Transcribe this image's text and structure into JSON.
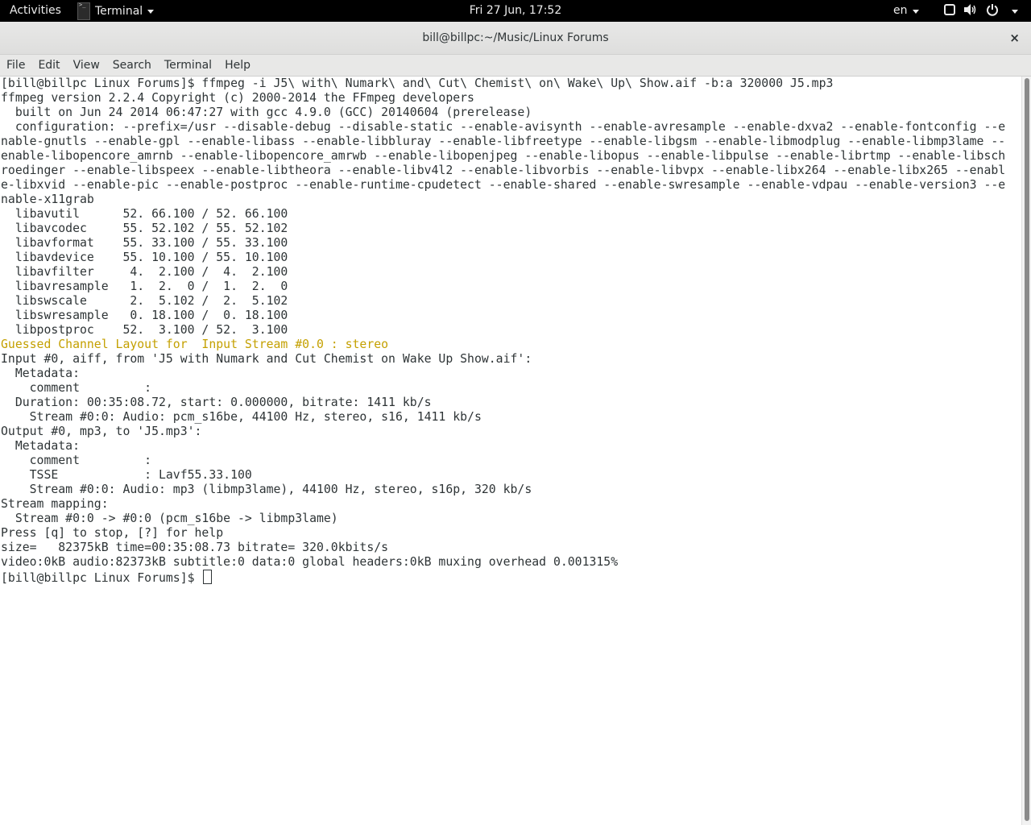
{
  "topbar": {
    "activities": "Activities",
    "app_name": "Terminal",
    "clock": "Fri 27 Jun, 17:52",
    "language": "en"
  },
  "window": {
    "title": "bill@billpc:~/Music/Linux Forums",
    "close": "×"
  },
  "menubar": {
    "items": [
      "File",
      "Edit",
      "View",
      "Search",
      "Terminal",
      "Help"
    ]
  },
  "terminal": {
    "lines": [
      "[bill@billpc Linux Forums]$ ffmpeg -i J5\\ with\\ Numark\\ and\\ Cut\\ Chemist\\ on\\ Wake\\ Up\\ Show.aif -b:a 320000 J5.mp3",
      "ffmpeg version 2.2.4 Copyright (c) 2000-2014 the FFmpeg developers",
      "  built on Jun 24 2014 06:47:27 with gcc 4.9.0 (GCC) 20140604 (prerelease)",
      "  configuration: --prefix=/usr --disable-debug --disable-static --enable-avisynth --enable-avresample --enable-dxva2 --enable-fontconfig --e",
      "nable-gnutls --enable-gpl --enable-libass --enable-libbluray --enable-libfreetype --enable-libgsm --enable-libmodplug --enable-libmp3lame --",
      "enable-libopencore_amrnb --enable-libopencore_amrwb --enable-libopenjpeg --enable-libopus --enable-libpulse --enable-librtmp --enable-libsch",
      "roedinger --enable-libspeex --enable-libtheora --enable-libv4l2 --enable-libvorbis --enable-libvpx --enable-libx264 --enable-libx265 --enabl",
      "e-libxvid --enable-pic --enable-postproc --enable-runtime-cpudetect --enable-shared --enable-swresample --enable-vdpau --enable-version3 --e",
      "nable-x11grab",
      "  libavutil      52. 66.100 / 52. 66.100",
      "  libavcodec     55. 52.102 / 55. 52.102",
      "  libavformat    55. 33.100 / 55. 33.100",
      "  libavdevice    55. 10.100 / 55. 10.100",
      "  libavfilter     4.  2.100 /  4.  2.100",
      "  libavresample   1.  2.  0 /  1.  2.  0",
      "  libswscale      2.  5.102 /  2.  5.102",
      "  libswresample   0. 18.100 /  0. 18.100",
      "  libpostproc    52.  3.100 / 52.  3.100",
      "Guessed Channel Layout for  Input Stream #0.0 : stereo",
      "Input #0, aiff, from 'J5 with Numark and Cut Chemist on Wake Up Show.aif':",
      "  Metadata:",
      "    comment         :",
      "  Duration: 00:35:08.72, start: 0.000000, bitrate: 1411 kb/s",
      "    Stream #0:0: Audio: pcm_s16be, 44100 Hz, stereo, s16, 1411 kb/s",
      "Output #0, mp3, to 'J5.mp3':",
      "  Metadata:",
      "    comment         :",
      "    TSSE            : Lavf55.33.100",
      "    Stream #0:0: Audio: mp3 (libmp3lame), 44100 Hz, stereo, s16p, 320 kb/s",
      "Stream mapping:",
      "  Stream #0:0 -> #0:0 (pcm_s16be -> libmp3lame)",
      "Press [q] to stop, [?] for help",
      "size=   82375kB time=00:35:08.73 bitrate= 320.0kbits/s",
      "video:0kB audio:82373kB subtitle:0 data:0 global headers:0kB muxing overhead 0.001315%"
    ],
    "warning_line_index": 18,
    "prompt": "[bill@billpc Linux Forums]$ ",
    "text_color": "#2e3436",
    "warning_color": "#c4a000"
  },
  "icons": {
    "app": "terminal-icon",
    "window_switch": "screen-icon",
    "volume": "volume-icon",
    "power": "power-icon",
    "close": "close-icon"
  }
}
